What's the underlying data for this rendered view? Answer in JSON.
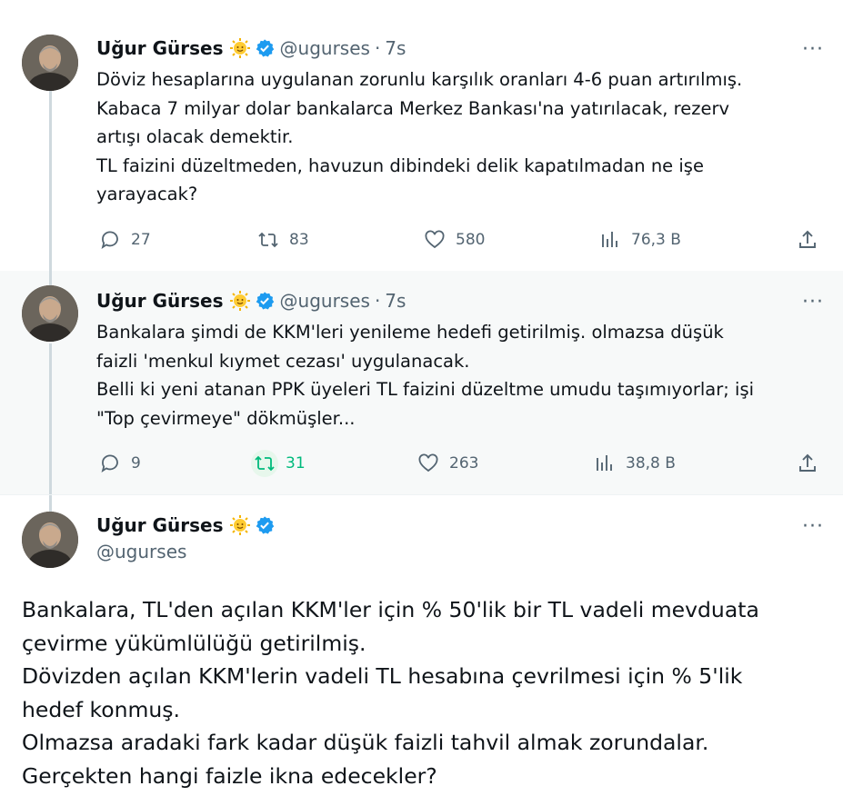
{
  "author": {
    "name": "Uğur Gürses",
    "handle": "@ugurses",
    "emoji_icon": "sun-emoji-icon",
    "verified_icon": "verified-badge-icon"
  },
  "more_label": "···",
  "tweets": [
    {
      "time_sep": "·",
      "time": "7s",
      "lines": [
        "Döviz hesaplarına uygulanan zorunlu karşılık oranları 4-6 puan artırılmış.",
        "Kabaca 7 milyar dolar bankalarca Merkez Bankası'na yatırılacak, rezerv",
        "artışı olacak demektir.",
        "TL faizini düzeltmeden, havuzun dibindeki delik kapatılmadan ne işe",
        "yarayacak?"
      ],
      "replies": "27",
      "retweets": "83",
      "likes": "580",
      "views": "76,3 B"
    },
    {
      "time_sep": "·",
      "time": "7s",
      "lines": [
        "Bankalara şimdi de KKM'leri yenileme hedefi getirilmiş. olmazsa düşük",
        "faizli 'menkul kıymet cezası' uygulanacak.",
        "Belli ki yeni atanan PPK üyeleri TL faizini düzeltme umudu taşımıyorlar; işi",
        "\"Top çevirmeye\" dökmüşler..."
      ],
      "replies": "9",
      "retweets": "31",
      "likes": "263",
      "views": "38,8 B"
    },
    {
      "lines": [
        "Bankalara, TL'den açılan KKM'ler için % 50'lik bir TL vadeli mevduata",
        "çevirme yükümlülüğü getirilmiş.",
        "Dövizden açılan KKM'lerin vadeli TL hesabına çevrilmesi için % 5'lik",
        "hedef konmuş.",
        "Olmazsa aradaki fark kadar düşük faizli tahvil almak zorundalar.",
        "Gerçekten hangi faizle ikna edecekler?"
      ]
    }
  ],
  "colors": {
    "text": "#0f1419",
    "secondary": "#536471",
    "verified": "#1d9bf0",
    "retweet_active": "#00ba7c",
    "highlight_bg": "#f7f9f9"
  }
}
